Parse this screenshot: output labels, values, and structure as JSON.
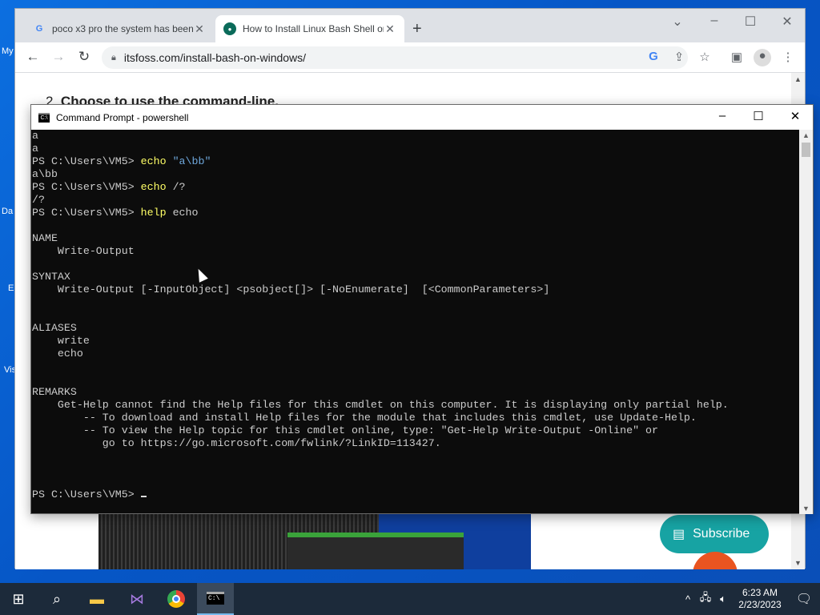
{
  "desktop": {
    "labels": [
      "My",
      "Da",
      "E",
      "Vis"
    ]
  },
  "browser": {
    "tabs": [
      {
        "title": "poco x3 pro the system has been",
        "favicon": "google-g-icon",
        "active": false
      },
      {
        "title": "How to Install Linux Bash Shell on",
        "favicon": "itsfoss-icon",
        "active": true
      }
    ],
    "url": "itsfoss.com/install-bash-on-windows/",
    "page": {
      "step_number": "2.",
      "step_text": "Choose to use the command-line.",
      "subscribe_label": "Subscribe"
    }
  },
  "cmd": {
    "title": "Command Prompt - powershell",
    "lines": [
      {
        "parts": [
          {
            "t": "a",
            "c": ""
          }
        ]
      },
      {
        "parts": [
          {
            "t": "a",
            "c": ""
          }
        ]
      },
      {
        "parts": [
          {
            "t": "PS C:\\Users\\VM5> ",
            "c": ""
          },
          {
            "t": "echo ",
            "c": "cmdword"
          },
          {
            "t": "\"a\\bb\"",
            "c": "strq"
          }
        ]
      },
      {
        "parts": [
          {
            "t": "a\\bb",
            "c": ""
          }
        ]
      },
      {
        "parts": [
          {
            "t": "PS C:\\Users\\VM5> ",
            "c": ""
          },
          {
            "t": "echo ",
            "c": "cmdword"
          },
          {
            "t": "/?",
            "c": ""
          }
        ]
      },
      {
        "parts": [
          {
            "t": "/?",
            "c": ""
          }
        ]
      },
      {
        "parts": [
          {
            "t": "PS C:\\Users\\VM5> ",
            "c": ""
          },
          {
            "t": "help ",
            "c": "cmdword"
          },
          {
            "t": "echo",
            "c": ""
          }
        ]
      },
      {
        "parts": [
          {
            "t": "",
            "c": ""
          }
        ]
      },
      {
        "parts": [
          {
            "t": "NAME",
            "c": ""
          }
        ]
      },
      {
        "parts": [
          {
            "t": "    Write-Output",
            "c": ""
          }
        ]
      },
      {
        "parts": [
          {
            "t": "",
            "c": ""
          }
        ]
      },
      {
        "parts": [
          {
            "t": "SYNTAX",
            "c": ""
          }
        ]
      },
      {
        "parts": [
          {
            "t": "    Write-Output [-InputObject] <psobject[]> [-NoEnumerate]  [<CommonParameters>]",
            "c": ""
          }
        ]
      },
      {
        "parts": [
          {
            "t": "",
            "c": ""
          }
        ]
      },
      {
        "parts": [
          {
            "t": "",
            "c": ""
          }
        ]
      },
      {
        "parts": [
          {
            "t": "ALIASES",
            "c": ""
          }
        ]
      },
      {
        "parts": [
          {
            "t": "    write",
            "c": ""
          }
        ]
      },
      {
        "parts": [
          {
            "t": "    echo",
            "c": ""
          }
        ]
      },
      {
        "parts": [
          {
            "t": "",
            "c": ""
          }
        ]
      },
      {
        "parts": [
          {
            "t": "",
            "c": ""
          }
        ]
      },
      {
        "parts": [
          {
            "t": "REMARKS",
            "c": ""
          }
        ]
      },
      {
        "parts": [
          {
            "t": "    Get-Help cannot find the Help files for this cmdlet on this computer. It is displaying only partial help.",
            "c": ""
          }
        ]
      },
      {
        "parts": [
          {
            "t": "        -- To download and install Help files for the module that includes this cmdlet, use Update-Help.",
            "c": ""
          }
        ]
      },
      {
        "parts": [
          {
            "t": "        -- To view the Help topic for this cmdlet online, type: \"Get-Help Write-Output -Online\" or",
            "c": ""
          }
        ]
      },
      {
        "parts": [
          {
            "t": "           go to https://go.microsoft.com/fwlink/?LinkID=113427.",
            "c": ""
          }
        ]
      },
      {
        "parts": [
          {
            "t": "",
            "c": ""
          }
        ]
      },
      {
        "parts": [
          {
            "t": "",
            "c": ""
          }
        ]
      },
      {
        "parts": [
          {
            "t": "",
            "c": ""
          }
        ]
      },
      {
        "parts": [
          {
            "t": "PS C:\\Users\\VM5> ",
            "c": ""
          }
        ]
      }
    ]
  },
  "taskbar": {
    "apps": [
      "start-icon",
      "search-icon",
      "file-explorer-icon",
      "visual-studio-icon",
      "chrome-icon",
      "command-prompt-icon"
    ],
    "time": "6:23 AM",
    "date": "2/23/2023"
  },
  "colors": {
    "console_bg": "#0c0c0c",
    "console_text": "#cccccc",
    "command_word": "#ffff66",
    "string_literal": "#6fa8dc",
    "subscribe_bg": "#17a3a3"
  }
}
